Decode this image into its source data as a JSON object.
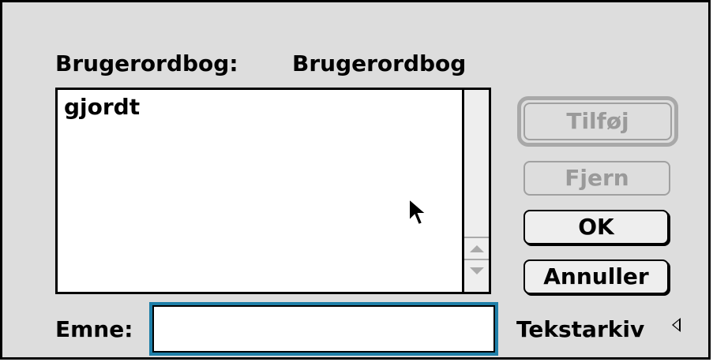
{
  "dictionary": {
    "label": "Brugerordbog:",
    "name": "Brugerordbog"
  },
  "word_list": {
    "items": [
      "gjordt"
    ]
  },
  "buttons": {
    "add_label": "Tilføj",
    "remove_label": "Fjern",
    "ok_label": "OK",
    "cancel_label": "Annuller"
  },
  "subject": {
    "label": "Emne:",
    "value": ""
  },
  "document_popup": {
    "label": "Tekstarkiv"
  },
  "colors": {
    "dialog_bg": "#dddddd",
    "focus_ring": "#1f7fa8",
    "disabled_text": "#9a9a9a"
  },
  "icons": {
    "pointer": "arrow-cursor-icon",
    "scroll_up": "scroll-up-arrow-icon",
    "scroll_down": "scroll-down-arrow-icon",
    "popup": "popup-triangle-icon"
  }
}
